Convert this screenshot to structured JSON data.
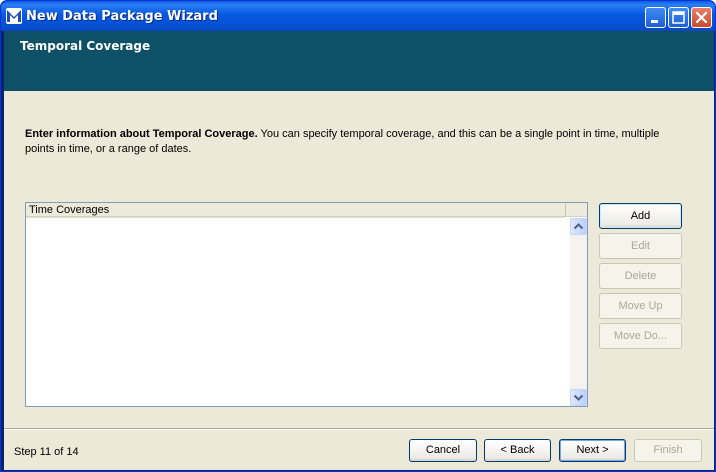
{
  "window": {
    "title": "New Data Package Wizard",
    "app_icon": "morpho-app-icon",
    "controls": [
      "minimize-icon",
      "maximize-icon",
      "close-icon"
    ]
  },
  "header": {
    "title": "Temporal Coverage"
  },
  "description": {
    "bold": "Enter information about Temporal Coverage.",
    "text": " You can specify temporal coverage, and this can be a single point in time, multiple points in time, or a range of dates."
  },
  "table": {
    "columns": [
      "Time Coverages"
    ],
    "rows": []
  },
  "side_buttons": {
    "add": "Add",
    "edit": "Edit",
    "delete": "Delete",
    "move_up": "Move Up",
    "move_down": "Move Do..."
  },
  "footer": {
    "step": "Step 11 of 14",
    "cancel": "Cancel",
    "back": "< Back",
    "next": "Next >",
    "finish": "Finish"
  },
  "colors": {
    "title_bar": "#0659e0",
    "header_band": "#0e5167",
    "client_bg": "#ece9d8",
    "disabled_text": "#aca899"
  }
}
